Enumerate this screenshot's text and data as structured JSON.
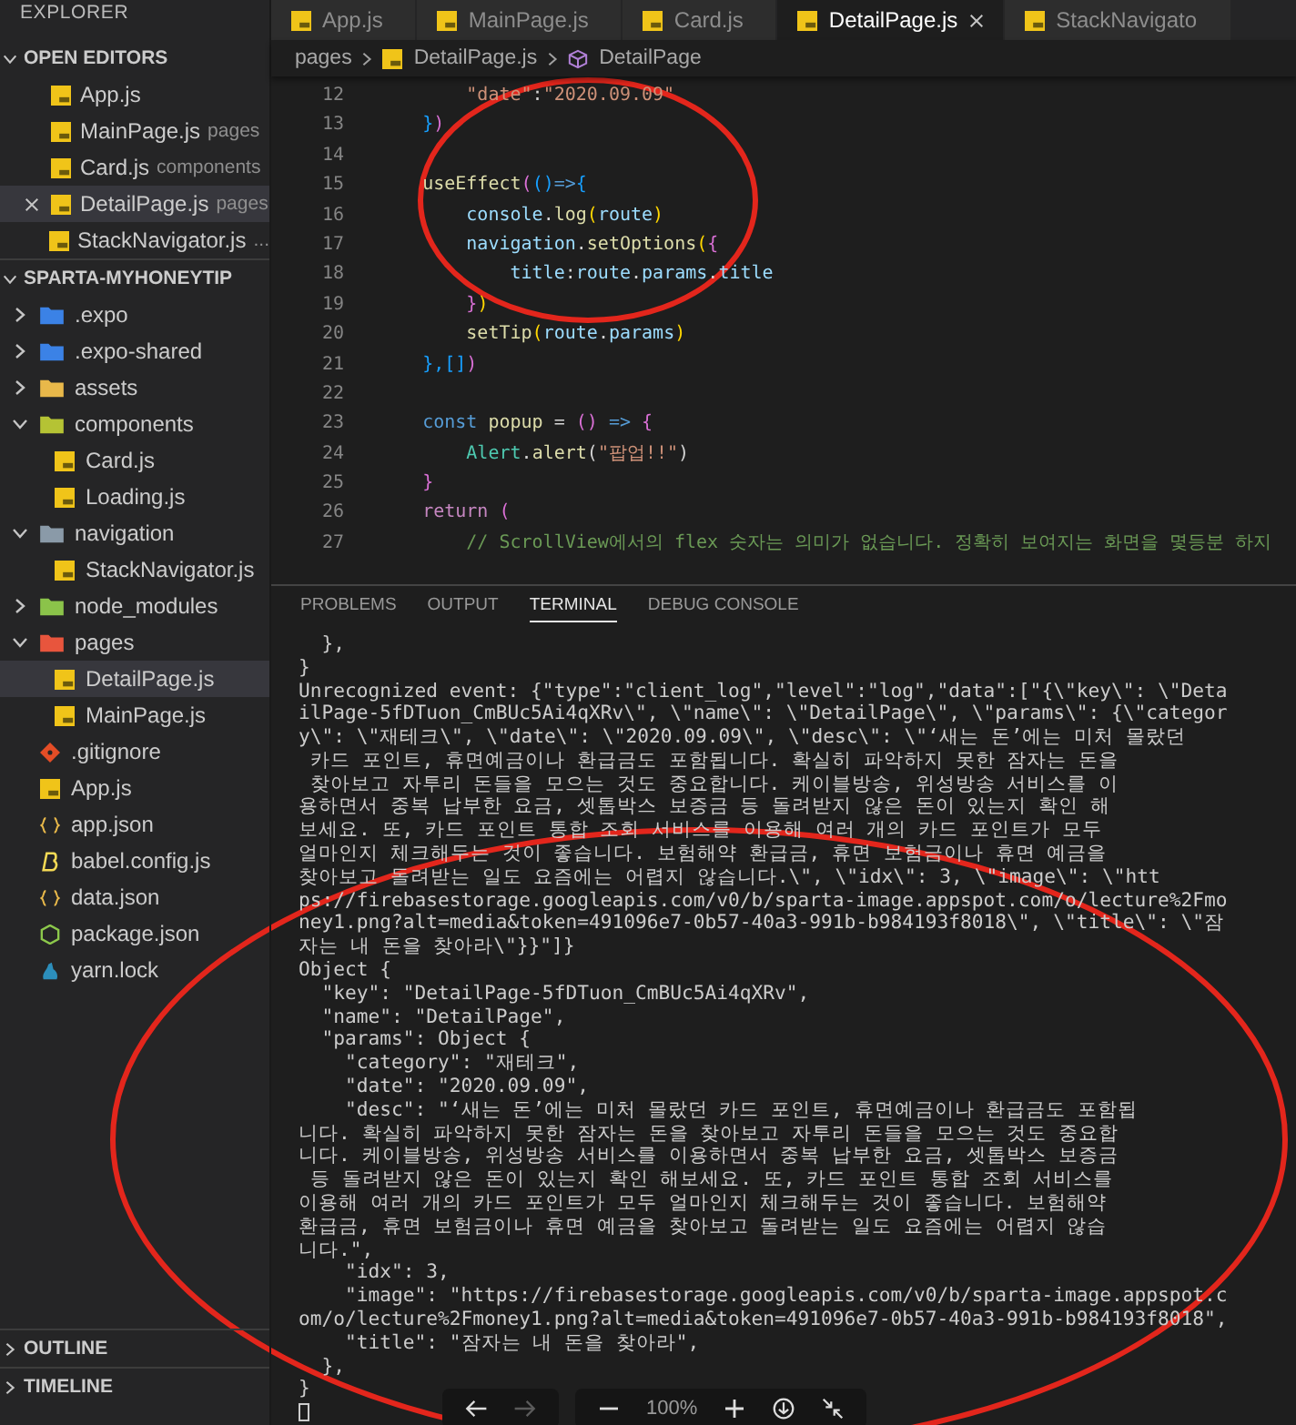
{
  "sidebar": {
    "title": "EXPLORER",
    "open_editors": {
      "title": "OPEN EDITORS",
      "expanded": true,
      "items": [
        {
          "name": "App.js",
          "kind": "js",
          "selected": false
        },
        {
          "name": "MainPage.js",
          "description": "pages",
          "kind": "js",
          "selected": false
        },
        {
          "name": "Card.js",
          "description": "components",
          "kind": "js",
          "selected": false
        },
        {
          "name": "DetailPage.js",
          "description": "pages",
          "kind": "js",
          "selected": true
        },
        {
          "name": "StackNavigator.js",
          "description": "...",
          "kind": "js",
          "selected": false
        }
      ]
    },
    "project": {
      "title": "SPARTA-MYHONEYTIP",
      "expanded": true,
      "tree": [
        {
          "name": ".expo",
          "kind": "expo",
          "expanded": false,
          "selected": false
        },
        {
          "name": ".expo-shared",
          "kind": "expo",
          "expanded": false,
          "selected": false
        },
        {
          "name": "assets",
          "kind": "assets",
          "expanded": false,
          "selected": false
        },
        {
          "name": "components",
          "kind": "components",
          "expanded": true,
          "selected": false,
          "children": [
            {
              "name": "Card.js",
              "kind": "js",
              "selected": false
            },
            {
              "name": "Loading.js",
              "kind": "js",
              "selected": false
            }
          ]
        },
        {
          "name": "navigation",
          "kind": "navigation",
          "expanded": true,
          "selected": false,
          "children": [
            {
              "name": "StackNavigator.js",
              "kind": "js",
              "selected": false
            }
          ]
        },
        {
          "name": "node_modules",
          "kind": "modules",
          "expanded": false,
          "selected": false
        },
        {
          "name": "pages",
          "kind": "pages",
          "expanded": true,
          "selected": false,
          "children": [
            {
              "name": "DetailPage.js",
              "kind": "js",
              "selected": true
            },
            {
              "name": "MainPage.js",
              "kind": "js",
              "selected": false
            }
          ]
        },
        {
          "name": ".gitignore",
          "kind": "git",
          "selected": false
        },
        {
          "name": "App.js",
          "kind": "js",
          "selected": false
        },
        {
          "name": "app.json",
          "kind": "json",
          "selected": false
        },
        {
          "name": "babel.config.js",
          "kind": "babel",
          "selected": false
        },
        {
          "name": "data.json",
          "kind": "json",
          "selected": false
        },
        {
          "name": "package.json",
          "kind": "package",
          "selected": false
        },
        {
          "name": "yarn.lock",
          "kind": "yarn",
          "selected": false
        }
      ]
    },
    "bottom_sections": [
      {
        "title": "OUTLINE",
        "expanded": false
      },
      {
        "title": "TIMELINE",
        "expanded": false
      }
    ]
  },
  "editor_tabs": [
    {
      "label": "App.js",
      "selected": false
    },
    {
      "label": "MainPage.js",
      "selected": false
    },
    {
      "label": "Card.js",
      "selected": false
    },
    {
      "label": "DetailPage.js",
      "selected": true
    },
    {
      "label": "StackNavigato",
      "selected": false
    }
  ],
  "breadcrumb": [
    {
      "label": "pages",
      "kind": "folder"
    },
    {
      "label": "DetailPage.js",
      "kind": "js"
    },
    {
      "label": "DetailPage",
      "kind": "symbol"
    }
  ],
  "code_lines": [
    {
      "number": "12",
      "tokens": [
        {
          "kind": "string",
          "text": "        \"date\""
        },
        {
          "kind": "plain",
          "text": ":"
        },
        {
          "kind": "string",
          "text": "\"2020.09.09\""
        }
      ]
    },
    {
      "number": "13",
      "tokens": [
        {
          "kind": "bracket3",
          "text": "    }"
        },
        {
          "kind": "bracket2",
          "text": ")"
        }
      ]
    },
    {
      "number": "14"
    },
    {
      "number": "15",
      "tokens": [
        {
          "kind": "func",
          "text": "    useEffect"
        },
        {
          "kind": "bracket2",
          "text": "("
        },
        {
          "kind": "bracket3",
          "text": "()"
        },
        {
          "kind": "keyword",
          "text": "=>"
        },
        {
          "kind": "bracket3",
          "text": "{"
        }
      ]
    },
    {
      "number": "16",
      "tokens": [
        {
          "kind": "var",
          "text": "        console"
        },
        {
          "kind": "plain",
          "text": "."
        },
        {
          "kind": "func",
          "text": "log"
        },
        {
          "kind": "bracket1",
          "text": "("
        },
        {
          "kind": "var",
          "text": "route"
        },
        {
          "kind": "bracket1",
          "text": ")"
        }
      ]
    },
    {
      "number": "17",
      "tokens": [
        {
          "kind": "var",
          "text": "        navigation"
        },
        {
          "kind": "plain",
          "text": "."
        },
        {
          "kind": "func",
          "text": "setOptions"
        },
        {
          "kind": "bracket1",
          "text": "("
        },
        {
          "kind": "bracket2",
          "text": "{"
        }
      ]
    },
    {
      "number": "18",
      "tokens": [
        {
          "kind": "var",
          "text": "            title"
        },
        {
          "kind": "plain",
          "text": ":"
        },
        {
          "kind": "var",
          "text": "route"
        },
        {
          "kind": "plain",
          "text": "."
        },
        {
          "kind": "var",
          "text": "params"
        },
        {
          "kind": "plain",
          "text": "."
        },
        {
          "kind": "var",
          "text": "title"
        }
      ]
    },
    {
      "number": "19",
      "tokens": [
        {
          "kind": "bracket2",
          "text": "        }"
        },
        {
          "kind": "bracket1",
          "text": ")"
        }
      ]
    },
    {
      "number": "20",
      "tokens": [
        {
          "kind": "func",
          "text": "        setTip"
        },
        {
          "kind": "bracket1",
          "text": "("
        },
        {
          "kind": "var",
          "text": "route"
        },
        {
          "kind": "plain",
          "text": "."
        },
        {
          "kind": "var",
          "text": "params"
        },
        {
          "kind": "bracket1",
          "text": ")"
        }
      ]
    },
    {
      "number": "21",
      "tokens": [
        {
          "kind": "bracket3",
          "text": "    },[]"
        },
        {
          "kind": "bracket2",
          "text": ")"
        }
      ]
    },
    {
      "number": "22"
    },
    {
      "number": "23",
      "tokens": [
        {
          "kind": "keyword",
          "text": "    const "
        },
        {
          "kind": "func",
          "text": "popup"
        },
        {
          "kind": "plain",
          "text": " = "
        },
        {
          "kind": "bracket2",
          "text": "() "
        },
        {
          "kind": "keyword",
          "text": "=> "
        },
        {
          "kind": "bracket2",
          "text": "{"
        }
      ]
    },
    {
      "number": "24",
      "tokens": [
        {
          "kind": "type",
          "text": "        Alert"
        },
        {
          "kind": "plain",
          "text": "."
        },
        {
          "kind": "func",
          "text": "alert"
        },
        {
          "kind": "plain",
          "text": "("
        },
        {
          "kind": "string",
          "text": "\"팝업!!\""
        },
        {
          "kind": "plain",
          "text": ")"
        }
      ]
    },
    {
      "number": "25",
      "tokens": [
        {
          "kind": "bracket2",
          "text": "    }"
        }
      ]
    },
    {
      "number": "26",
      "tokens": [
        {
          "kind": "keyword2",
          "text": "    return "
        },
        {
          "kind": "bracket2",
          "text": "("
        }
      ]
    },
    {
      "number": "27",
      "tokens": [
        {
          "kind": "comment",
          "text": "        // ScrollView에서의 flex 숫자는 의미가 없습니다. 정확히 보여지는 화면을 몇등분 하지"
        }
      ]
    }
  ],
  "panel": {
    "tabs": [
      {
        "label": "PROBLEMS",
        "selected": false
      },
      {
        "label": "OUTPUT",
        "selected": false
      },
      {
        "label": "TERMINAL",
        "selected": true
      },
      {
        "label": "DEBUG CONSOLE",
        "selected": false
      }
    ],
    "terminal_lines": [
      "  },",
      "}",
      "Unrecognized event: {\"type\":\"client_log\",\"level\":\"log\",\"data\":[\"{\\\"key\\\": \\\"Deta",
      "ilPage-5fDTuon_CmBUc5Ai4qXRv\\\", \\\"name\\\": \\\"DetailPage\\\", \\\"params\\\": {\\\"categor",
      "y\\\": \\\"재테크\\\", \\\"date\\\": \\\"2020.09.09\\\", \\\"desc\\\": \\\"‘새는 돈’에는 미처 몰랐던",
      " 카드 포인트, 휴면예금이나 환급금도 포함됩니다. 확실히 파악하지 못한 잠자는 돈을",
      " 찾아보고 자투리 돈들을 모으는 것도 중요합니다. 케이블방송, 위성방송 서비스를 이",
      "용하면서 중복 납부한 요금, 셋톱박스 보증금 등 돌려받지 않은 돈이 있는지 확인 해",
      "보세요. 또, 카드 포인트 통합 조회 서비스를 이용해 여러 개의 카드 포인트가 모두",
      "얼마인지 체크해두는 것이 좋습니다. 보험해약 환급금, 휴면 보험금이나 휴면 예금을",
      "찾아보고 돌려받는 일도 요즘에는 어렵지 않습니다.\\\", \\\"idx\\\": 3, \\\"image\\\": \\\"htt",
      "ps://firebasestorage.googleapis.com/v0/b/sparta-image.appspot.com/o/lecture%2Fmo",
      "ney1.png?alt=media&token=491096e7-0b57-40a3-991b-b984193f8018\\\", \\\"title\\\": \\\"잠",
      "자는 내 돈을 찾아라\\\"}}\"]}",
      "Object {",
      "  \"key\": \"DetailPage-5fDTuon_CmBUc5Ai4qXRv\",",
      "  \"name\": \"DetailPage\",",
      "  \"params\": Object {",
      "    \"category\": \"재테크\",",
      "    \"date\": \"2020.09.09\",",
      "    \"desc\": \"‘새는 돈’에는 미처 몰랐던 카드 포인트, 휴면예금이나 환급금도 포함됩",
      "니다. 확실히 파악하지 못한 잠자는 돈을 찾아보고 자투리 돈들을 모으는 것도 중요합",
      "니다. 케이블방송, 위성방송 서비스를 이용하면서 중복 납부한 요금, 셋톱박스 보증금",
      " 등 돌려받지 않은 돈이 있는지 확인 해보세요. 또, 카드 포인트 통합 조회 서비스를",
      "이용해 여러 개의 카드 포인트가 모두 얼마인지 체크해두는 것이 좋습니다. 보험해약",
      "환급금, 휴면 보험금이나 휴면 예금을 찾아보고 돌려받는 일도 요즘에는 어렵지 않습",
      "니다.\",",
      "    \"idx\": 3,",
      "    \"image\": \"https://firebasestorage.googleapis.com/v0/b/sparta-image.appspot.c",
      "om/o/lecture%2Fmoney1.png?alt=media&token=491096e7-0b57-40a3-991b-b984193f8018\",",
      "    \"title\": \"잠자는 내 돈을 찾아라\",",
      "  },",
      "}"
    ]
  },
  "viewer_toolbar": {
    "zoom": "100%",
    "forward_disabled": true
  },
  "annotations": [
    {
      "kind": "ellipse"
    },
    {
      "kind": "ellipse"
    }
  ]
}
